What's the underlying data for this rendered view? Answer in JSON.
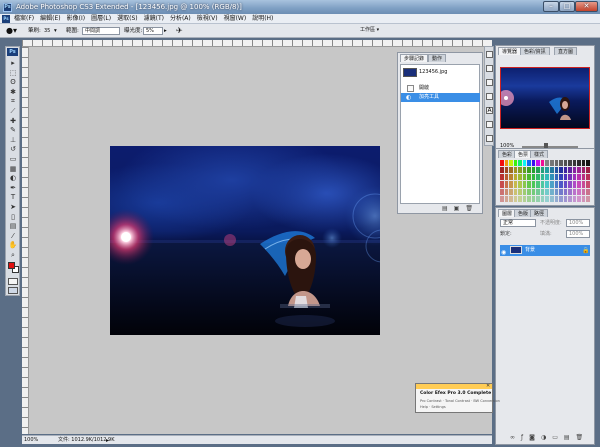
{
  "titlebar": {
    "icon_label": "Ps",
    "title": "Adobe Photoshop CS3 Extended - [123456.jpg @ 100% (RGB/8)]",
    "min": "–",
    "max": "□",
    "close": "✕"
  },
  "menubar": {
    "icon_label": "Ps",
    "items": [
      "檔案(F)",
      "編輯(E)",
      "影像(I)",
      "圖層(L)",
      "選取(S)",
      "濾鏡(T)",
      "分析(A)",
      "檢視(V)",
      "視窗(W)",
      "說明(H)"
    ]
  },
  "options": {
    "brush_label": "筆刷:",
    "brush_size": "35",
    "mode_label": "範圍:",
    "mode_value": "中間調",
    "exposure_label": "曝光度:",
    "exposure_value": "5%",
    "workspace_label": "工作區 ▾"
  },
  "toolbox": {
    "logo": "Ps",
    "tools": [
      {
        "name": "move-tool-icon",
        "glyph": "▸"
      },
      {
        "name": "marquee-tool-icon",
        "glyph": "⬚"
      },
      {
        "name": "lasso-tool-icon",
        "glyph": "ʘ"
      },
      {
        "name": "magic-wand-tool-icon",
        "glyph": "✱"
      },
      {
        "name": "crop-tool-icon",
        "glyph": "⌗"
      },
      {
        "name": "slice-tool-icon",
        "glyph": "⟋"
      },
      {
        "name": "healing-brush-tool-icon",
        "glyph": "✚"
      },
      {
        "name": "brush-tool-icon",
        "glyph": "✎"
      },
      {
        "name": "clone-stamp-tool-icon",
        "glyph": "⊥"
      },
      {
        "name": "history-brush-tool-icon",
        "glyph": "↺"
      },
      {
        "name": "eraser-tool-icon",
        "glyph": "▭"
      },
      {
        "name": "gradient-tool-icon",
        "glyph": "▦"
      },
      {
        "name": "dodge-tool-icon",
        "glyph": "◐"
      },
      {
        "name": "pen-tool-icon",
        "glyph": "✒"
      },
      {
        "name": "type-tool-icon",
        "glyph": "T"
      },
      {
        "name": "path-selection-tool-icon",
        "glyph": "➤"
      },
      {
        "name": "shape-tool-icon",
        "glyph": "▯"
      },
      {
        "name": "notes-tool-icon",
        "glyph": "▤"
      },
      {
        "name": "eyedropper-tool-icon",
        "glyph": "⁄"
      },
      {
        "name": "hand-tool-icon",
        "glyph": "✋"
      },
      {
        "name": "zoom-tool-icon",
        "glyph": "⌕"
      }
    ],
    "foreground_color": "#e01010",
    "background_color": "#ffffff"
  },
  "status": {
    "zoom": "100%",
    "doc_info": "文件: 1012.9K/1012.9K"
  },
  "history": {
    "tab_active": "步驟記錄",
    "tab_other": "動作",
    "snapshot_label": "123456.jpg",
    "steps": [
      "開啟",
      "加亮工具"
    ]
  },
  "navigator": {
    "tabs": [
      "導覽器",
      "色彩/資訊",
      "直方圖"
    ],
    "zoom": "100%"
  },
  "swatches": {
    "tabs": [
      "色彩",
      "色票",
      "樣式"
    ]
  },
  "layers": {
    "tabs": [
      "圖層",
      "色版",
      "路徑"
    ],
    "blend_mode": "正常",
    "opacity_label": "不透明度:",
    "opacity_value": "100%",
    "lock_label": "鎖定:",
    "fill_label": "填滿:",
    "fill_value": "100%",
    "layer_name": "背景"
  },
  "plugin": {
    "title": "Color Efex Pro 3.0 Complete",
    "line1": "Pro Contrast · Tonal Contrast · BW Conversion",
    "line2": "Help · Settings"
  }
}
